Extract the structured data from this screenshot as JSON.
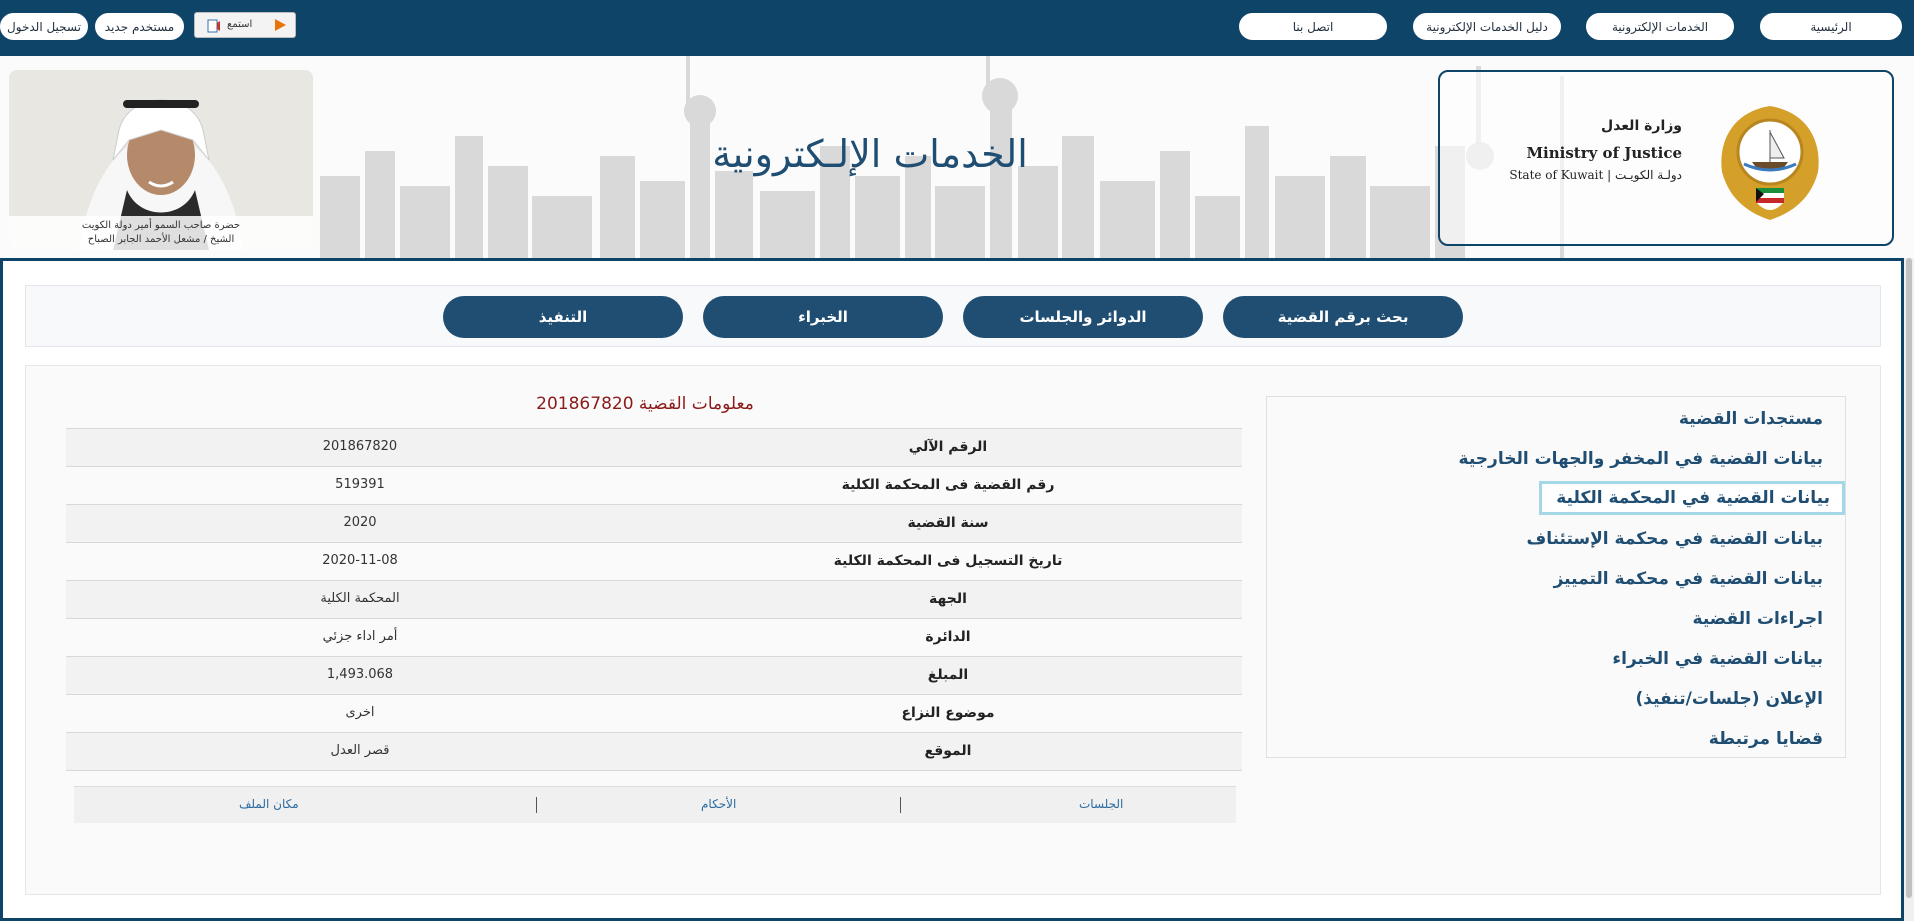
{
  "topnav": {
    "home": "الرئيسية",
    "eservices": "الخدمات الإلكترونية",
    "guide": "دليل الخدمات الإلكترونية",
    "contact": "اتصل بنا",
    "new_user": "مستخدم جديد",
    "login": "تسجيل الدخول",
    "listen": "استمع"
  },
  "header": {
    "title": "الخدمات الإلـكترونية",
    "ministry_ar": "وزارة العدل",
    "ministry_en": "Ministry of Justice",
    "state_text": "State of Kuwait  |  دولـة الكويـت",
    "portrait_caption_1": "حضرة صاحب السمو أمير دولة الكويت",
    "portrait_caption_2": "الشيخ / مشعل الأحمد الجابر الصباح"
  },
  "main_nav": [
    {
      "label": "بحث برقم القضية"
    },
    {
      "label": "الدوائر والجلسات"
    },
    {
      "label": "الخبراء"
    },
    {
      "label": "التنفيذ"
    }
  ],
  "sidebar": {
    "items": [
      {
        "label": "مستجدات القضية"
      },
      {
        "label": "بيانات القضية في المخفر والجهات الخارجية"
      },
      {
        "label": "بيانات القضية في المحكمة الكلية"
      },
      {
        "label": "بيانات القضية في محكمة الإستئناف"
      },
      {
        "label": "بيانات القضية في محكمة التمييز"
      },
      {
        "label": "اجراءات القضية"
      },
      {
        "label": "بيانات القضية في الخبراء"
      },
      {
        "label": "الإعلان (جلسات/تنفيذ)"
      },
      {
        "label": "قضايا مرتبطة"
      }
    ]
  },
  "case_info": {
    "title": "معلومات القضية 201867820",
    "rows": [
      {
        "key": "الرقم الآلي",
        "value": "201867820"
      },
      {
        "key": "رقم القضية فى المحكمة الكلية",
        "value": "519391"
      },
      {
        "key": "سنة القضية",
        "value": "2020"
      },
      {
        "key": "تاريخ التسجيل فى المحكمة الكلية",
        "value": "2020-11-08"
      },
      {
        "key": "الجهة",
        "value": "المحكمة الكلية"
      },
      {
        "key": "الدائرة",
        "value": "أمر اداء جزئي"
      },
      {
        "key": "المبلغ",
        "value": "1,493.068"
      },
      {
        "key": "موضوع النزاع",
        "value": "اخرى"
      },
      {
        "key": "الموقع",
        "value": "قصر العدل"
      }
    ],
    "tabs": {
      "sessions": "الجلسات",
      "judgments": "الأحكام",
      "file_location": "مكان الملف"
    }
  },
  "colors": {
    "primary": "#0f4469",
    "button": "#1f4e72",
    "title_red": "#8b1a1a",
    "highlight": "#a5d8e6"
  }
}
